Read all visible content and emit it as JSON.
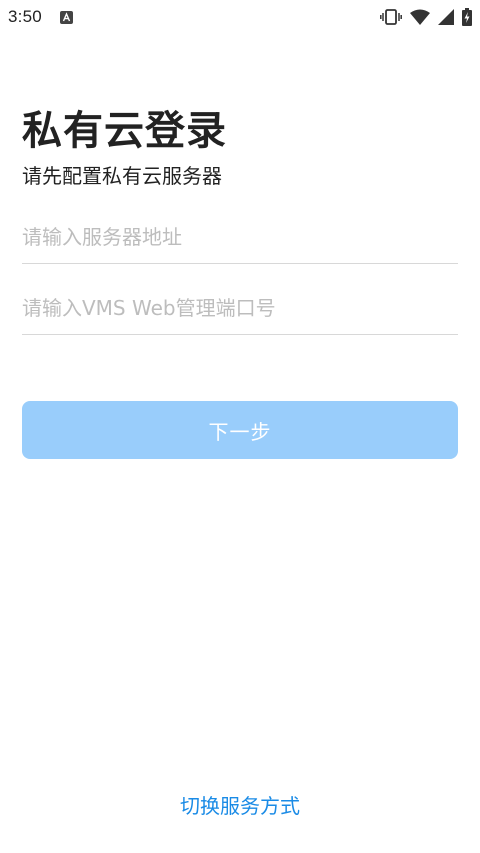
{
  "status_bar": {
    "time": "3:50",
    "app_icon": "a-box-icon",
    "icons": [
      "vibrate-icon",
      "wifi-icon",
      "signal-icon",
      "battery-charging-icon"
    ]
  },
  "login": {
    "title": "私有云登录",
    "subtitle": "请先配置私有云服务器",
    "server_input": {
      "placeholder": "请输入服务器地址",
      "value": ""
    },
    "port_input": {
      "placeholder": "请输入VMS Web管理端口号",
      "value": ""
    },
    "next_label": "下一步",
    "switch_label": "切换服务方式"
  },
  "colors": {
    "button_bg": "#99cdfb",
    "link": "#1a8be6",
    "placeholder": "#bdbdbd",
    "divider": "#d8d8d8"
  }
}
